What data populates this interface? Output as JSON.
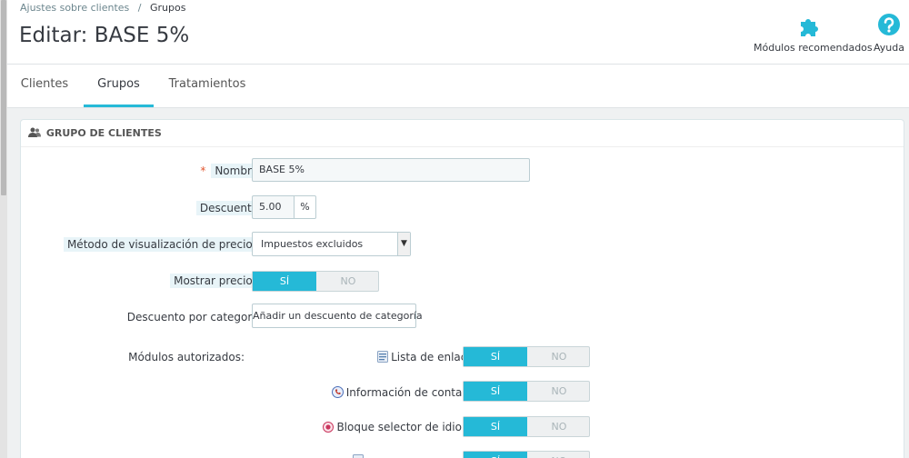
{
  "breadcrumb": {
    "parent": "Ajustes sobre clientes",
    "separator": "/",
    "current": "Grupos"
  },
  "page_title": "Editar: BASE 5%",
  "toolbar": {
    "modules_label": "Módulos recomendados",
    "modules_icon": "puzzle-icon",
    "help_label": "Ayuda",
    "help_icon": "question-circle-icon"
  },
  "tabs": [
    {
      "label": "Clientes",
      "active": false
    },
    {
      "label": "Grupos",
      "active": true
    },
    {
      "label": "Tratamientos",
      "active": false
    }
  ],
  "panel": {
    "heading": "GRUPO DE CLIENTES",
    "heading_icon": "users-icon"
  },
  "form": {
    "name": {
      "label": "Nombre",
      "required_mark": "*",
      "value": "BASE 5%"
    },
    "discount": {
      "label": "Descuento",
      "value": "5.00",
      "unit": "%"
    },
    "price_display": {
      "label": "Método de visualización de precios",
      "value": "Impuestos excluidos"
    },
    "show_prices": {
      "label": "Mostrar precios",
      "on_label": "SÍ",
      "off_label": "NO",
      "value": "SÍ"
    },
    "category_discount": {
      "label": "Descuento por categoría",
      "button_label": "Añadir un descuento de categoría"
    },
    "authorized_modules": {
      "label": "Módulos autorizados:",
      "items": [
        {
          "name": "Lista de enlaces",
          "icon": "link-list-icon",
          "on_label": "SÍ",
          "off_label": "NO",
          "value": "SÍ"
        },
        {
          "name": "Información de contacto",
          "icon": "contact-info-icon",
          "on_label": "SÍ",
          "off_label": "NO",
          "value": "SÍ"
        },
        {
          "name": "Bloque selector de idioma",
          "icon": "language-selector-icon",
          "on_label": "SÍ",
          "off_label": "NO",
          "value": "SÍ"
        },
        {
          "name": "",
          "icon": "module-icon",
          "on_label": "SÍ",
          "off_label": "NO",
          "value": "SÍ"
        }
      ]
    }
  },
  "colors": {
    "accent": "#25b9d7",
    "required": "#e2562f",
    "text": "#363a41"
  }
}
